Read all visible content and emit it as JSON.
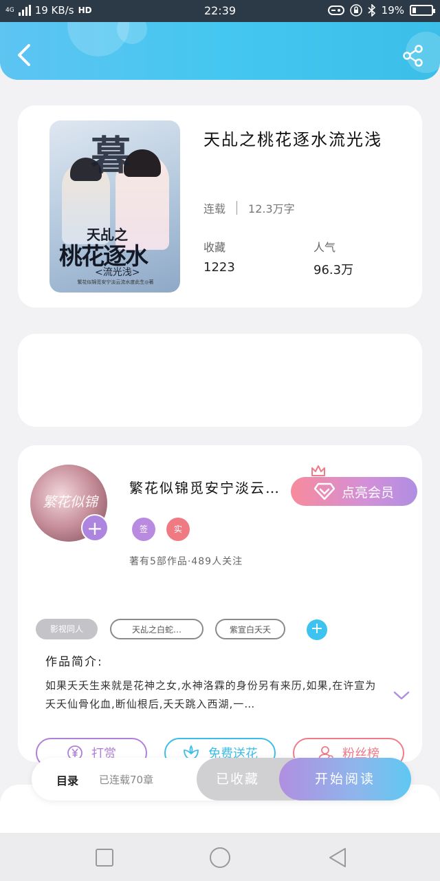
{
  "status_bar": {
    "network": "4G",
    "speed": "19 KB/s",
    "hd": "HD",
    "time": "22:39",
    "battery": "19%",
    "battery_level": 0.19
  },
  "book": {
    "title": "天乩之桃花逐水流光浅",
    "status": "连载",
    "word_count": "12.3万字",
    "favorites_label": "收藏",
    "favorites_value": "1223",
    "popularity_label": "人气",
    "popularity_value": "96.3万",
    "cover": {
      "big_char": "暮",
      "title_line1": "天乩之",
      "title_line2": "桃花逐水",
      "title_line3": "<流光浅>",
      "credit": "繁花似锦觅安宁淡云流水度此生◎著"
    }
  },
  "author": {
    "name": "繁花似锦觅安宁淡云流水度此生",
    "avatar_text": "繁花似锦",
    "vip_button": "点亮会员",
    "badge_sign": "签",
    "badge_real": "实",
    "works_info": "著有5部作品·489人关注",
    "tags": [
      "影视同人",
      "天乩之白蛇…",
      "紫宣白夭夭"
    ],
    "intro_heading": "作品简介:",
    "intro_text": "如果夭夭生来就是花神之女,水神洛霖的身份另有来历,如果,在许宣为夭夭仙骨化血,断仙根后,夭夭跳入西湖,一…"
  },
  "actions": {
    "reward": "打赏",
    "flowers": "免费送花",
    "fans": "粉丝榜"
  },
  "bottom_bar": {
    "toc": "目录",
    "chapter_status": "已连载70章",
    "collected": "已收藏",
    "start_reading": "开始阅读"
  },
  "colors": {
    "header": "#44c7f0",
    "accent_blue": "#3ec3f0",
    "accent_purple": "#ad84e0",
    "reward": "#b07fd8",
    "flowers": "#3bbde8",
    "fans": "#f07a88"
  },
  "icons": [
    "back-icon",
    "share-icon",
    "diamond-icon",
    "crown-icon",
    "plus-icon",
    "chevron-down-icon",
    "yen-icon",
    "flower-icon",
    "user-icon",
    "square-icon",
    "circle-icon",
    "triangle-back-icon"
  ]
}
